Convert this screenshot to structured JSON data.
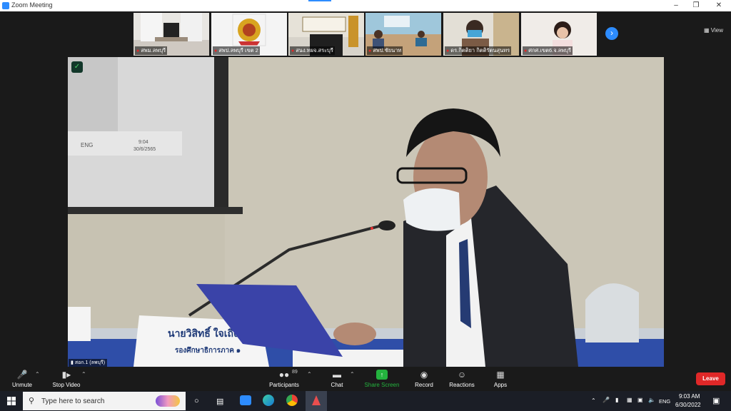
{
  "window": {
    "title": "Zoom Meeting"
  },
  "gallery": [
    {
      "name": "สพม.ลพบุรี"
    },
    {
      "name": "สพป.ลพบุรี เขต 2"
    },
    {
      "name": "สนง.ทผจ.สระบุรี"
    },
    {
      "name": "สพป.ชัยนาท"
    },
    {
      "name": "ดร.กิตติยา กิตติรัตนสุนทร"
    },
    {
      "name": "ศกศ.เขต6.จ.ลพบุรี"
    }
  ],
  "view_button": "View",
  "main_video": {
    "speaker_label": "สอก.1 (ลพบุรี)",
    "name_card_title": "นายวิสิทธิ์ ใจเถิง",
    "name_card_subtitle": "รองศึกษาธิการภาค ๑",
    "screen_time": "9:04",
    "screen_date": "30/6/2565",
    "screen_lang": "ENG"
  },
  "toolbar": {
    "unmute": "Unmute",
    "stop_video": "Stop Video",
    "participants": "Participants",
    "participants_count": "89",
    "chat": "Chat",
    "share_screen": "Share Screen",
    "record": "Record",
    "reactions": "Reactions",
    "apps": "Apps",
    "leave": "Leave"
  },
  "taskbar": {
    "search_placeholder": "Type here to search",
    "lang": "ENG",
    "time": "9:03 AM",
    "date": "6/30/2022"
  },
  "colors": {
    "accent": "#2d8cff",
    "leave": "#e02828",
    "share": "#24b33e"
  }
}
